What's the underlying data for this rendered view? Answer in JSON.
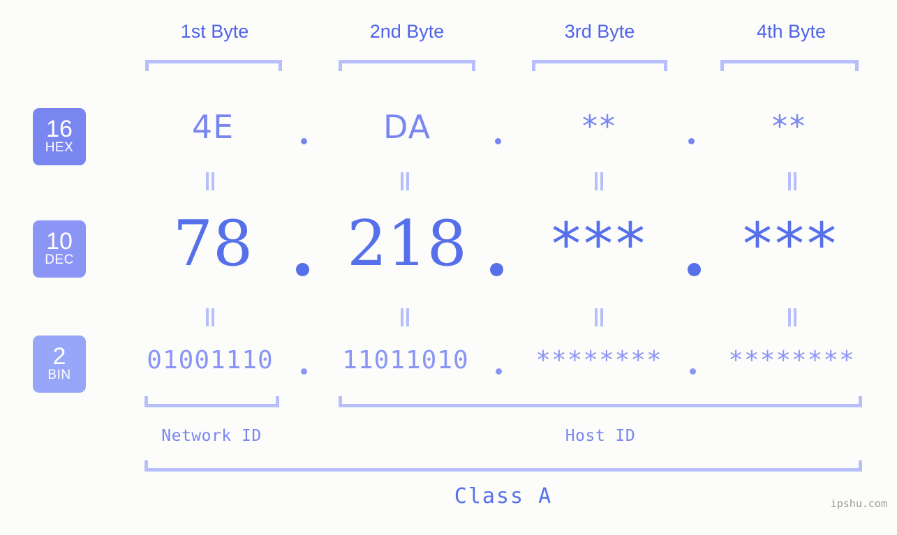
{
  "meta": {
    "background_color": "#fcfdfa",
    "accent_color": "#5670ea",
    "accent_mid_color": "#7986f0",
    "accent_light_color": "#b6bffc"
  },
  "byte_headers": [
    {
      "label": "1st Byte"
    },
    {
      "label": "2nd Byte"
    },
    {
      "label": "3rd Byte"
    },
    {
      "label": "4th Byte"
    }
  ],
  "rows": [
    {
      "badge": {
        "number": "16",
        "name": "HEX",
        "color": "#7986f0"
      },
      "values": [
        "4E",
        "DA",
        "**",
        "**"
      ],
      "separator": "."
    },
    {
      "badge": {
        "number": "10",
        "name": "DEC",
        "color": "#8b95f5"
      },
      "values": [
        "78",
        "218",
        "***",
        "***"
      ],
      "separator": "."
    },
    {
      "badge": {
        "number": "2",
        "name": "BIN",
        "color": "#97a6f9"
      },
      "values": [
        "01001110",
        "11011010",
        "********",
        "********"
      ],
      "separator": "."
    }
  ],
  "connectors": {
    "symbol": "parallel-equals"
  },
  "id_sections": [
    {
      "label": "Network ID"
    },
    {
      "label": "Host ID"
    }
  ],
  "class": {
    "label": "Class A"
  },
  "watermark": {
    "text": "ipshu.com"
  }
}
